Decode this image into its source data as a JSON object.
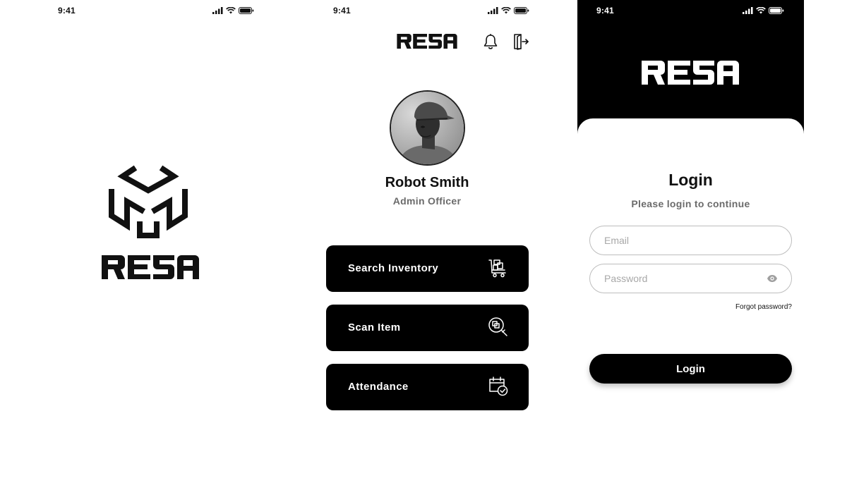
{
  "status_bar": {
    "time": "9:41"
  },
  "brand": {
    "name": "RESA"
  },
  "home": {
    "profile": {
      "name": "Robot Smith",
      "role": "Admin Officer"
    },
    "menu": [
      {
        "label": "Search Inventory",
        "icon": "cart-icon"
      },
      {
        "label": "Scan Item",
        "icon": "scan-search-icon"
      },
      {
        "label": "Attendance",
        "icon": "calendar-check-icon"
      }
    ]
  },
  "login": {
    "title": "Login",
    "subtitle": "Please login to continue",
    "email_placeholder": "Email",
    "password_placeholder": "Password",
    "forgot_password": "Forgot password?",
    "button_label": "Login"
  },
  "colors": {
    "primary": "#000000",
    "background": "#ffffff",
    "muted_text": "#6b6b6b",
    "field_border": "#bdbdbd"
  }
}
